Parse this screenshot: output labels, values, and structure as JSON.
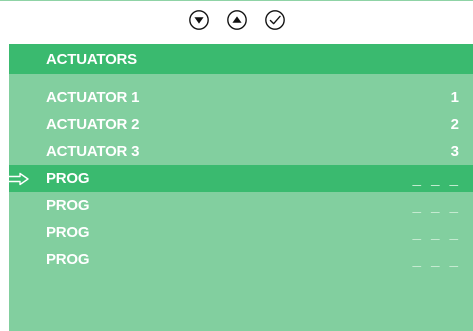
{
  "toolbar": {
    "buttons": [
      {
        "icon": "down-arrow-circle-icon"
      },
      {
        "icon": "up-arrow-circle-icon"
      },
      {
        "icon": "checkmark-circle-icon"
      }
    ]
  },
  "menu": {
    "title": "ACTUATORS",
    "items": [
      {
        "label": "ACTUATOR 1",
        "value": "1"
      },
      {
        "label": "ACTUATOR 2",
        "value": "2"
      },
      {
        "label": "ACTUATOR 3",
        "value": "3"
      },
      {
        "label": "PROG",
        "value": "_ _ _"
      },
      {
        "label": "PROG",
        "value": "_ _ _"
      },
      {
        "label": "PROG",
        "value": "_ _ _"
      },
      {
        "label": "PROG",
        "value": "_ _ _"
      }
    ],
    "selected_icon": "right-arrow-pointer-icon"
  },
  "colors": {
    "panel": "#82cf9f",
    "header": "#3aba6f",
    "selected": "#3aba6f",
    "text": "#ffffff"
  }
}
